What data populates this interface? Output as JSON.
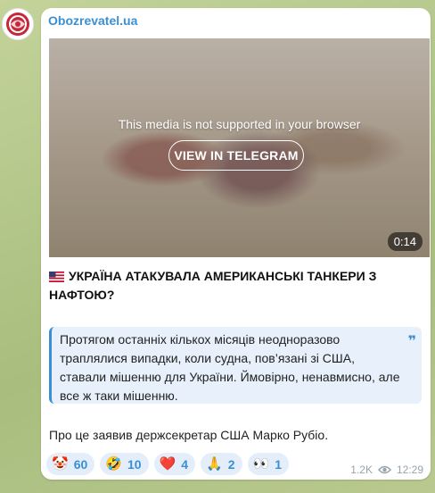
{
  "post": {
    "channel_name": "Obozrevatel.ua",
    "media": {
      "unsupported_text": "This media is not supported in your browser",
      "button_label": "VIEW IN TELEGRAM",
      "duration": "0:14"
    },
    "headline": "УКРАЇНА АТАКУВАЛА АМЕРИКАНСЬКІ ТАНКЕРИ З НАФТОЮ?",
    "quote": "Протягом останніх кількох місяців неодноразово траплялися випадки, коли судна, пов’язані зі США, ставали мішенню для України. Ймовірно, ненавмисно, але все ж таки мішенню.",
    "body": "Про це заявив держсекретар США Марко Рубіо.",
    "reactions": [
      {
        "emoji": "🤡",
        "count": "60"
      },
      {
        "emoji": "🤣",
        "count": "10"
      },
      {
        "emoji": "❤️",
        "count": "4"
      },
      {
        "emoji": "🙏",
        "count": "2"
      },
      {
        "emoji": "👀",
        "count": "1"
      }
    ],
    "views": "1.2K",
    "time": "12:29"
  },
  "icons": {
    "avatar": "globe-logo-icon",
    "flag": "us-flag-icon",
    "views": "eye-icon"
  },
  "colors": {
    "accent": "#3a8fd3",
    "quote_bg": "#e8f1fb",
    "reaction_bg": "#e4eefa"
  }
}
